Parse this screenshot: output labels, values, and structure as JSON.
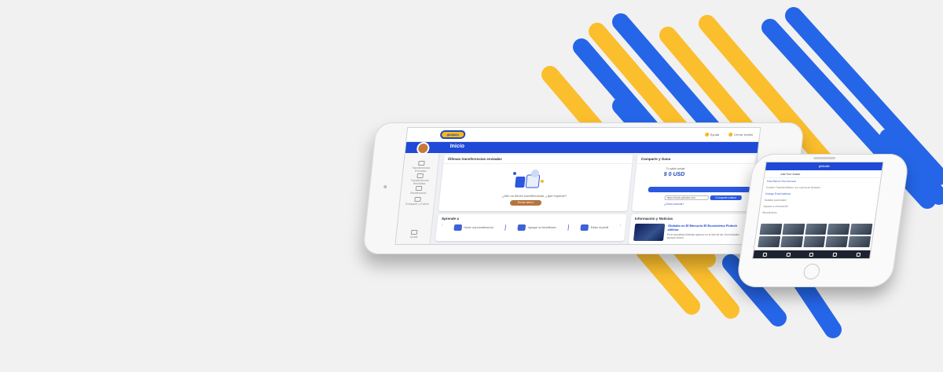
{
  "colors": {
    "background": "#f1f1f1",
    "blue": "#2566e8",
    "yellow": "#fbbe2d",
    "tablet_brand": "#1f49d6"
  },
  "tablet": {
    "logo": "globalia",
    "top_right": [
      "Ayuda",
      "Cerrar sesión"
    ],
    "page_title": "Inicio",
    "sidebar": [
      "Transferencias Enviadas",
      "Transferencias Recibidas",
      "Beneficiarios",
      "Compartir y Cobrar"
    ],
    "sidebar_bottom": "Ayuda",
    "transfers_card": {
      "title": "Últimas transferencias enviadas",
      "empty_text": "¿Aún no tienes transferencias, ¿qué esperas?",
      "button": "Enviar dinero"
    },
    "share_card": {
      "title": "Comparte y Gana",
      "saldo_label": "Tu saldo actual",
      "saldo": "$ 0 USD",
      "link": "https://itrans.globalia.com",
      "share_button": "Compartir enlace",
      "help_link": "¿Cómo funciona?"
    },
    "learn_card": {
      "title": "Aprende a",
      "items": [
        "Hacer una transferencia",
        "Agregar un beneficiario",
        "Editar mi perfil"
      ]
    },
    "news_card": {
      "title": "Información y Noticias",
      "headline": "Globalia en El Mercurio El Ecosistema Fintech chileno",
      "body": "En la actualidad Globalia aparece en la lista de las 10 principales startups fintech"
    }
  },
  "phone": {
    "header": "globalia",
    "subheader": "Add Your Avatar",
    "lines": [
      "Hola Renzo! Your Account",
      "Confirm Transfers/Monto a tu cuenta de Globalia",
      "Change Email Address"
    ],
    "details": [
      "Detalles personales",
      "Ingresa tu información",
      "Beneficiarios"
    ]
  }
}
